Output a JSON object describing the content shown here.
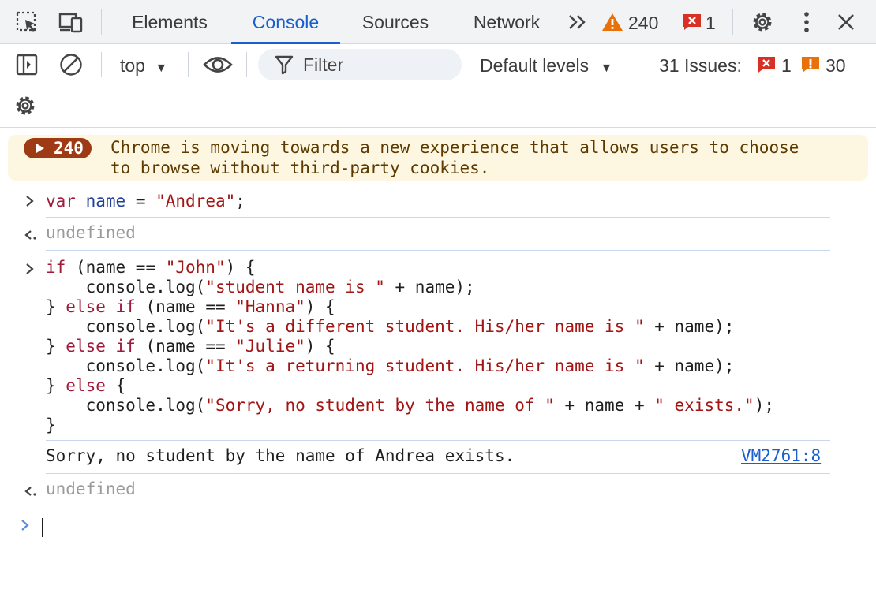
{
  "tabs": {
    "elements": "Elements",
    "console": "Console",
    "sources": "Sources",
    "network": "Network"
  },
  "counts": {
    "warnings": "240",
    "errors": "1"
  },
  "toolbar": {
    "context": "top",
    "filter_placeholder": "Filter",
    "levels": "Default levels",
    "issues_label": "31 Issues:",
    "issues_errors": "1",
    "issues_warnings": "30"
  },
  "banner": {
    "badge": "240",
    "line1": "Chrome is moving towards a new experience that allows users to choose",
    "line2": "to browse without third-party cookies."
  },
  "console": {
    "cmd1": {
      "kw": "var",
      "name": "name",
      "eq": " = ",
      "str": "\"Andrea\"",
      "end": ";"
    },
    "result1": "undefined",
    "code": {
      "l1_kw": "if",
      "l1_a": " (name == ",
      "l1_str": "\"John\"",
      "l1_b": ") {",
      "l2_a": "    console.log(",
      "l2_str": "\"student name is \"",
      "l2_b": " + name);",
      "l3_a": "} ",
      "l3_kw": "else if",
      "l3_b": " (name == ",
      "l3_str": "\"Hanna\"",
      "l3_c": ") {",
      "l4_a": "    console.log(",
      "l4_str": "\"It's a different student. His/her name is \"",
      "l4_b": " + name);",
      "l5_a": "} ",
      "l5_kw": "else if",
      "l5_b": " (name == ",
      "l5_str": "\"Julie\"",
      "l5_c": ") {",
      "l6_a": "    console.log(",
      "l6_str": "\"It's a returning student. His/her name is \"",
      "l6_b": " + name);",
      "l7_a": "} ",
      "l7_kw": "else",
      "l7_b": " {",
      "l8_a": "    console.log(",
      "l8_str1": "\"Sorry, no student by the name of \"",
      "l8_b": " + name + ",
      "l8_str2": "\" exists.\"",
      "l8_c": ");",
      "l9": "}"
    },
    "log_output": "Sorry, no student by the name of Andrea exists.",
    "log_source": "VM2761:8",
    "result2": "undefined"
  },
  "colors": {
    "accent": "#1a5fd0",
    "warning": "#e8710a",
    "error": "#d93025",
    "banner_bg": "#fdf7e1",
    "badge_bg": "#9e3b14"
  }
}
